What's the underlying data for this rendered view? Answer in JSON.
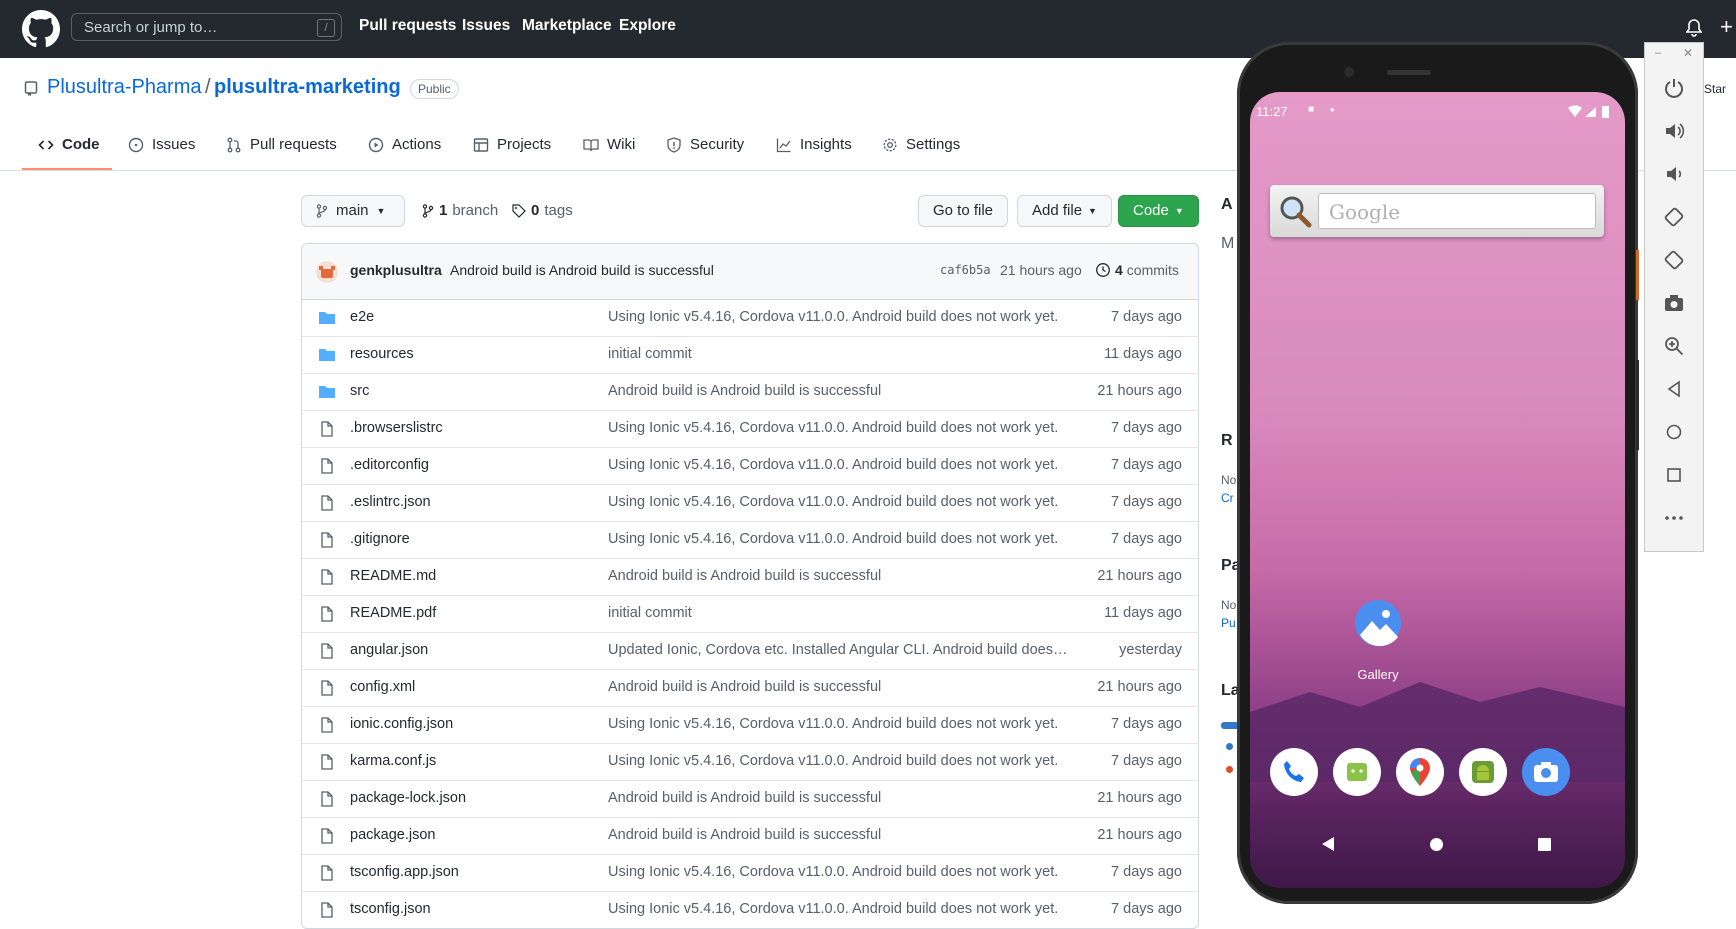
{
  "header": {
    "search_placeholder": "Search or jump to…",
    "search_shortcut": "/",
    "nav": [
      "Pull requests",
      "Issues",
      "Marketplace",
      "Explore"
    ],
    "plus": "+"
  },
  "repo": {
    "owner": "Plusultra-Pharma",
    "separator": "/",
    "name": "plusultra-marketing",
    "visibility": "Public",
    "star_partial": "Star"
  },
  "tabs": [
    "Code",
    "Issues",
    "Pull requests",
    "Actions",
    "Projects",
    "Wiki",
    "Security",
    "Insights",
    "Settings"
  ],
  "toolbar": {
    "branch": "main",
    "branch_count": "1",
    "branch_label": "branch",
    "tag_count": "0",
    "tag_label": "tags",
    "go_to_file": "Go to file",
    "add_file": "Add file",
    "code": "Code"
  },
  "commit": {
    "author": "genkplusultra",
    "message": "Android build is Android build is successful",
    "sha": "caf6b5a",
    "time": "21 hours ago",
    "count": "4",
    "count_label": "commits"
  },
  "files": [
    {
      "type": "dir",
      "name": "e2e",
      "message": "Using Ionic v5.4.16, Cordova v11.0.0. Android build does not work yet.",
      "age": "7 days ago"
    },
    {
      "type": "dir",
      "name": "resources",
      "message": "initial commit",
      "age": "11 days ago"
    },
    {
      "type": "dir",
      "name": "src",
      "message": "Android build is Android build is successful",
      "age": "21 hours ago"
    },
    {
      "type": "file",
      "name": ".browserslistrc",
      "message": "Using Ionic v5.4.16, Cordova v11.0.0. Android build does not work yet.",
      "age": "7 days ago"
    },
    {
      "type": "file",
      "name": ".editorconfig",
      "message": "Using Ionic v5.4.16, Cordova v11.0.0. Android build does not work yet.",
      "age": "7 days ago"
    },
    {
      "type": "file",
      "name": ".eslintrc.json",
      "message": "Using Ionic v5.4.16, Cordova v11.0.0. Android build does not work yet.",
      "age": "7 days ago"
    },
    {
      "type": "file",
      "name": ".gitignore",
      "message": "Using Ionic v5.4.16, Cordova v11.0.0. Android build does not work yet.",
      "age": "7 days ago"
    },
    {
      "type": "file",
      "name": "README.md",
      "message": "Android build is Android build is successful",
      "age": "21 hours ago"
    },
    {
      "type": "file",
      "name": "README.pdf",
      "message": "initial commit",
      "age": "11 days ago"
    },
    {
      "type": "file",
      "name": "angular.json",
      "message": "Updated Ionic, Cordova etc. Installed Angular CLI. Android build does…",
      "age": "yesterday"
    },
    {
      "type": "file",
      "name": "config.xml",
      "message": "Android build is Android build is successful",
      "age": "21 hours ago"
    },
    {
      "type": "file",
      "name": "ionic.config.json",
      "message": "Using Ionic v5.4.16, Cordova v11.0.0. Android build does not work yet.",
      "age": "7 days ago"
    },
    {
      "type": "file",
      "name": "karma.conf.js",
      "message": "Using Ionic v5.4.16, Cordova v11.0.0. Android build does not work yet.",
      "age": "7 days ago"
    },
    {
      "type": "file",
      "name": "package-lock.json",
      "message": "Android build is Android build is successful",
      "age": "21 hours ago"
    },
    {
      "type": "file",
      "name": "package.json",
      "message": "Android build is Android build is successful",
      "age": "21 hours ago"
    },
    {
      "type": "file",
      "name": "tsconfig.app.json",
      "message": "Using Ionic v5.4.16, Cordova v11.0.0. Android build does not work yet.",
      "age": "7 days ago"
    },
    {
      "type": "file",
      "name": "tsconfig.json",
      "message": "Using Ionic v5.4.16, Cordova v11.0.0. Android build does not work yet.",
      "age": "7 days ago"
    }
  ],
  "sidebar_partial": {
    "about": "A",
    "m": "M",
    "releases": "R",
    "no1": "No",
    "cr": "Cr",
    "packages": "Pa",
    "no2": "No",
    "pu": "Pu",
    "languages": "La"
  },
  "phone": {
    "time": "11:27",
    "search_placeholder": "Google",
    "gallery_label": "Gallery"
  },
  "colors": {
    "header_bg": "#24292f",
    "link": "#0969da",
    "green": "#2da44e",
    "tab_underline": "#fd8c73"
  }
}
